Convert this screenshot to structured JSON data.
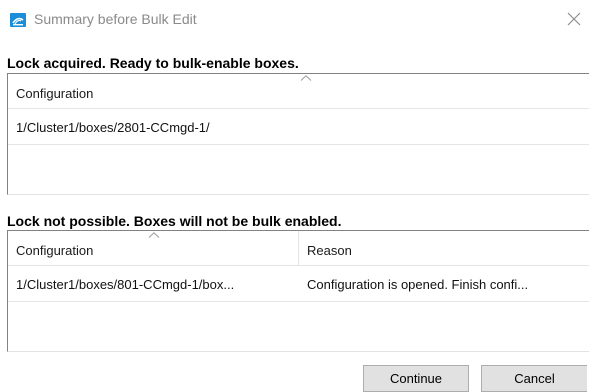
{
  "window": {
    "title": "Summary before Bulk Edit",
    "app_icon": "app-icon",
    "close_icon": "close-icon"
  },
  "acquired": {
    "label": "Lock acquired. Ready to bulk-enable boxes.",
    "columns": [
      "Configuration"
    ],
    "rows": [
      [
        "1/Cluster1/boxes/2801-CCmgd-1/"
      ]
    ]
  },
  "not_possible": {
    "label": "Lock not possible. Boxes will not be bulk enabled.",
    "columns": [
      "Configuration",
      "Reason"
    ],
    "rows": [
      [
        "1/Cluster1/boxes/801-CCmgd-1/box...",
        "Configuration is opened. Finish confi..."
      ]
    ]
  },
  "buttons": {
    "continue": "Continue",
    "cancel": "Cancel"
  },
  "colors": {
    "accent": "#1a8fd8",
    "button_face": "#e1e1e1",
    "button_border": "#adadad"
  }
}
